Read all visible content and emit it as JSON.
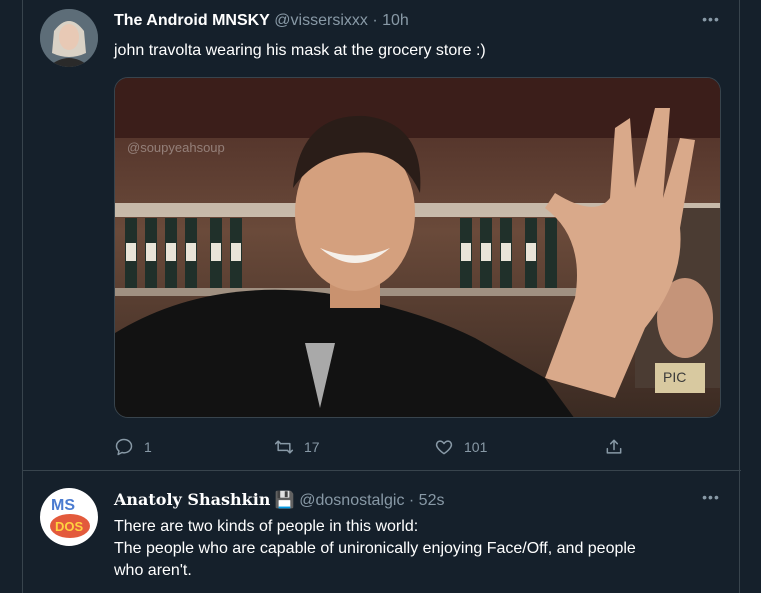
{
  "tweets": [
    {
      "display_name": "The Android MNSKY",
      "handle": "@vissersixxx",
      "separator": "·",
      "time": "10h",
      "text": "john travolta wearing his mask at the grocery store :)",
      "media": {
        "watermark": "@soupyeahsoup",
        "store_sign_text": "PIC"
      },
      "actions": {
        "reply_count": "1",
        "retweet_count": "17",
        "like_count": "101"
      },
      "more_label": "•••"
    },
    {
      "display_name": "Anatoly Shashkin",
      "name_emoji": "💾",
      "handle": "@dosnostalgic",
      "separator": "·",
      "time": "52s",
      "text_line1": "There are two kinds of people in this world:",
      "text_line2": "The people who are capable of unironically enjoying Face/Off, and people",
      "text_line3": "who aren't.",
      "avatar_letters_top": "MS",
      "avatar_letters_bottom": "DOS",
      "more_label": "•••"
    }
  ],
  "colors": {
    "background": "#15202b",
    "border": "#38444d",
    "secondary_text": "#8899a6",
    "primary_text": "#ffffff"
  },
  "icons": [
    "reply-icon",
    "retweet-icon",
    "like-icon",
    "share-icon",
    "more-icon"
  ]
}
